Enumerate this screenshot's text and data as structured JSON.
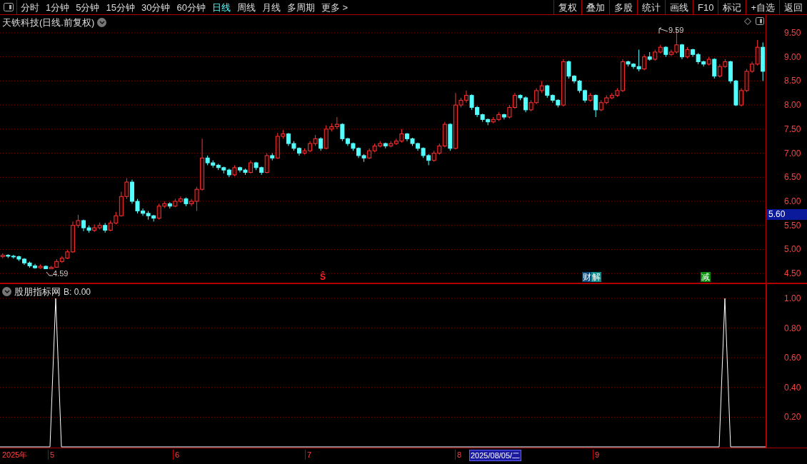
{
  "toolbar": {
    "periods": [
      {
        "label": "分时",
        "selected": false
      },
      {
        "label": "1分钟",
        "selected": false
      },
      {
        "label": "5分钟",
        "selected": false
      },
      {
        "label": "15分钟",
        "selected": false
      },
      {
        "label": "30分钟",
        "selected": false
      },
      {
        "label": "60分钟",
        "selected": false
      },
      {
        "label": "日线",
        "selected": true
      },
      {
        "label": "周线",
        "selected": false
      },
      {
        "label": "月线",
        "selected": false
      },
      {
        "label": "多周期",
        "selected": false
      },
      {
        "label": "更多 >",
        "selected": false
      }
    ],
    "buttons": [
      "复权",
      "叠加",
      "多股",
      "统计",
      "画线",
      "F10",
      "标记",
      "+自选",
      "返回"
    ]
  },
  "price_chart": {
    "title": "天铁科技(日线.前复权)",
    "high_label": "9.59",
    "low_label": "4.59",
    "event_marks": [
      {
        "text": "Ŝ",
        "kind": "signal"
      },
      {
        "text": "财",
        "kind": "finance"
      },
      {
        "text": "解",
        "kind": "unlock"
      },
      {
        "text": "减",
        "kind": "reduce"
      }
    ],
    "current_price": "5.60",
    "chart_data": {
      "type": "candlestick",
      "grid": true,
      "ylim": [
        4.31,
        9.87
      ],
      "categories": [
        null,
        null,
        null,
        null,
        null,
        null,
        null,
        null,
        null,
        null,
        null,
        null,
        null,
        null,
        null,
        null,
        null,
        null,
        null,
        null,
        null,
        null,
        null,
        null,
        null,
        null,
        null,
        null,
        null,
        null,
        null,
        null,
        null,
        null,
        null,
        null,
        null,
        null,
        null,
        null,
        null,
        null,
        null,
        null,
        null,
        null,
        null,
        null,
        null,
        null,
        null,
        null,
        null,
        null,
        null,
        null,
        null,
        null,
        null,
        null,
        null,
        null,
        null,
        null,
        null,
        null,
        null,
        null,
        null,
        null,
        null,
        null,
        null,
        null,
        null,
        null,
        null,
        null,
        null,
        null,
        null,
        null,
        null,
        null,
        null,
        null,
        null,
        null,
        null,
        null,
        null,
        null,
        null,
        null,
        null,
        null,
        null,
        null,
        null,
        null,
        null,
        null,
        null,
        null,
        null,
        null,
        null,
        null,
        null,
        null,
        null,
        null,
        null,
        null,
        null,
        null,
        null,
        null,
        null,
        null,
        null,
        null,
        null,
        null,
        null,
        null,
        null,
        null,
        null,
        null,
        null,
        null,
        null,
        null,
        null,
        null,
        null,
        null,
        null,
        null,
        null,
        null
      ],
      "yticks": [
        {
          "value": 9.5,
          "label": "9.50"
        },
        {
          "value": 9,
          "label": "9.00"
        },
        {
          "value": 8.5,
          "label": "8.50"
        },
        {
          "value": 8,
          "label": "8.00"
        },
        {
          "value": 7.5,
          "label": "7.50"
        },
        {
          "value": 7,
          "label": "7.00"
        },
        {
          "value": 6.5,
          "label": "6.50"
        },
        {
          "value": 6,
          "label": "6.00"
        },
        {
          "value": 5.5,
          "label": "5.50"
        },
        {
          "value": 5,
          "label": "5.00"
        },
        {
          "value": 4.5,
          "label": "4.50"
        }
      ],
      "ohlc": [
        [
          4.85,
          4.92,
          4.82,
          4.88
        ],
        [
          4.88,
          4.9,
          4.82,
          4.86
        ],
        [
          4.86,
          4.89,
          4.81,
          4.85
        ],
        [
          4.85,
          4.87,
          4.76,
          4.8
        ],
        [
          4.8,
          4.82,
          4.68,
          4.72
        ],
        [
          4.72,
          4.75,
          4.62,
          4.66
        ],
        [
          4.66,
          4.7,
          4.6,
          4.62
        ],
        [
          4.62,
          4.69,
          4.6,
          4.65
        ],
        [
          4.65,
          4.67,
          4.59,
          4.6
        ],
        [
          4.6,
          4.66,
          4.6,
          4.63
        ],
        [
          4.63,
          4.8,
          4.62,
          4.75
        ],
        [
          4.75,
          4.86,
          4.72,
          4.82
        ],
        [
          4.82,
          4.99,
          4.8,
          4.95
        ],
        [
          4.95,
          5.58,
          4.93,
          5.5
        ],
        [
          5.5,
          5.72,
          5.45,
          5.6
        ],
        [
          5.6,
          5.62,
          5.38,
          5.45
        ],
        [
          5.45,
          5.5,
          5.35,
          5.4
        ],
        [
          5.4,
          5.52,
          5.36,
          5.45
        ],
        [
          5.45,
          5.56,
          5.42,
          5.5
        ],
        [
          5.5,
          5.55,
          5.35,
          5.4
        ],
        [
          5.4,
          5.6,
          5.38,
          5.55
        ],
        [
          5.55,
          5.78,
          5.52,
          5.7
        ],
        [
          5.7,
          6.2,
          5.68,
          6.1
        ],
        [
          6.1,
          6.48,
          6.05,
          6.4
        ],
        [
          6.4,
          6.45,
          5.95,
          6.0
        ],
        [
          6.0,
          6.05,
          5.75,
          5.8
        ],
        [
          5.8,
          5.85,
          5.7,
          5.75
        ],
        [
          5.75,
          5.8,
          5.62,
          5.7
        ],
        [
          5.7,
          5.72,
          5.58,
          5.65
        ],
        [
          5.65,
          5.95,
          5.62,
          5.9
        ],
        [
          5.9,
          6.0,
          5.86,
          5.95
        ],
        [
          5.95,
          5.98,
          5.85,
          5.9
        ],
        [
          5.9,
          6.05,
          5.88,
          6.0
        ],
        [
          6.0,
          6.1,
          5.97,
          6.05
        ],
        [
          6.05,
          6.08,
          5.9,
          5.95
        ],
        [
          5.95,
          6.05,
          5.9,
          6.0
        ],
        [
          6.0,
          6.3,
          5.8,
          6.25
        ],
        [
          6.25,
          7.3,
          6.22,
          6.9
        ],
        [
          6.9,
          6.95,
          6.75,
          6.8
        ],
        [
          6.8,
          6.85,
          6.7,
          6.75
        ],
        [
          6.75,
          6.78,
          6.65,
          6.7
        ],
        [
          6.7,
          6.72,
          6.58,
          6.65
        ],
        [
          6.65,
          6.68,
          6.5,
          6.55
        ],
        [
          6.55,
          6.75,
          6.52,
          6.7
        ],
        [
          6.7,
          6.72,
          6.6,
          6.65
        ],
        [
          6.65,
          6.68,
          6.55,
          6.6
        ],
        [
          6.6,
          6.85,
          6.58,
          6.8
        ],
        [
          6.8,
          6.82,
          6.65,
          6.7
        ],
        [
          6.7,
          6.72,
          6.55,
          6.6
        ],
        [
          6.6,
          7.0,
          6.58,
          6.95
        ],
        [
          6.95,
          7.0,
          6.85,
          6.9
        ],
        [
          6.9,
          7.42,
          6.88,
          7.35
        ],
        [
          7.35,
          7.48,
          7.3,
          7.4
        ],
        [
          7.4,
          7.42,
          7.15,
          7.2
        ],
        [
          7.2,
          7.25,
          7.05,
          7.1
        ],
        [
          7.1,
          7.12,
          6.95,
          7.0
        ],
        [
          7.0,
          7.1,
          6.97,
          7.05
        ],
        [
          7.05,
          7.25,
          7.02,
          7.2
        ],
        [
          7.2,
          7.38,
          7.15,
          7.3
        ],
        [
          7.3,
          7.33,
          7.05,
          7.1
        ],
        [
          7.1,
          7.58,
          7.08,
          7.5
        ],
        [
          7.5,
          7.62,
          7.45,
          7.55
        ],
        [
          7.55,
          7.75,
          7.5,
          7.6
        ],
        [
          7.6,
          7.62,
          7.25,
          7.3
        ],
        [
          7.3,
          7.32,
          7.15,
          7.2
        ],
        [
          7.2,
          7.22,
          7.05,
          7.1
        ],
        [
          7.1,
          7.12,
          6.9,
          6.95
        ],
        [
          6.95,
          6.98,
          6.82,
          6.9
        ],
        [
          6.9,
          7.1,
          6.88,
          7.05
        ],
        [
          7.05,
          7.2,
          7.02,
          7.15
        ],
        [
          7.15,
          7.25,
          7.12,
          7.2
        ],
        [
          7.2,
          7.22,
          7.1,
          7.15
        ],
        [
          7.15,
          7.25,
          7.12,
          7.2
        ],
        [
          7.2,
          7.3,
          7.17,
          7.25
        ],
        [
          7.25,
          7.5,
          7.22,
          7.4
        ],
        [
          7.4,
          7.42,
          7.25,
          7.3
        ],
        [
          7.3,
          7.32,
          7.15,
          7.2
        ],
        [
          7.2,
          7.22,
          7.05,
          7.1
        ],
        [
          7.1,
          7.12,
          6.9,
          6.95
        ],
        [
          6.95,
          6.98,
          6.75,
          6.85
        ],
        [
          6.85,
          7.05,
          6.82,
          7.0
        ],
        [
          7.0,
          7.2,
          6.97,
          7.15
        ],
        [
          7.15,
          7.65,
          7.12,
          7.6
        ],
        [
          7.6,
          7.62,
          7.05,
          7.1
        ],
        [
          7.1,
          8.25,
          7.08,
          8.0
        ],
        [
          8.0,
          8.15,
          7.95,
          8.1
        ],
        [
          8.1,
          8.3,
          8.05,
          8.2
        ],
        [
          8.2,
          8.22,
          7.9,
          7.95
        ],
        [
          7.95,
          7.98,
          7.75,
          7.8
        ],
        [
          7.8,
          7.82,
          7.65,
          7.7
        ],
        [
          7.7,
          7.72,
          7.58,
          7.65
        ],
        [
          7.65,
          7.75,
          7.62,
          7.7
        ],
        [
          7.7,
          7.85,
          7.67,
          7.8
        ],
        [
          7.8,
          7.82,
          7.7,
          7.75
        ],
        [
          7.75,
          8.0,
          7.72,
          7.95
        ],
        [
          7.95,
          8.25,
          7.92,
          8.2
        ],
        [
          8.2,
          8.22,
          8.1,
          8.15
        ],
        [
          8.15,
          8.18,
          7.85,
          7.9
        ],
        [
          7.9,
          8.1,
          7.87,
          8.05
        ],
        [
          8.05,
          8.35,
          8.02,
          8.3
        ],
        [
          8.3,
          8.5,
          8.25,
          8.4
        ],
        [
          8.4,
          8.42,
          8.15,
          8.2
        ],
        [
          8.2,
          8.22,
          8.05,
          8.1
        ],
        [
          8.1,
          8.12,
          7.95,
          8.0
        ],
        [
          8.0,
          8.95,
          7.97,
          8.9
        ],
        [
          8.9,
          8.92,
          8.55,
          8.6
        ],
        [
          8.6,
          8.62,
          8.45,
          8.5
        ],
        [
          8.5,
          8.52,
          8.25,
          8.3
        ],
        [
          8.3,
          8.32,
          8.05,
          8.1
        ],
        [
          8.1,
          8.25,
          8.07,
          8.2
        ],
        [
          8.2,
          8.22,
          7.75,
          7.9
        ],
        [
          7.9,
          8.1,
          7.87,
          8.05
        ],
        [
          8.05,
          8.2,
          8.02,
          8.15
        ],
        [
          8.15,
          8.25,
          8.12,
          8.2
        ],
        [
          8.2,
          8.35,
          8.17,
          8.3
        ],
        [
          8.3,
          8.95,
          8.27,
          8.9
        ],
        [
          8.9,
          8.92,
          8.8,
          8.85
        ],
        [
          8.85,
          8.87,
          8.75,
          8.8
        ],
        [
          8.8,
          9.15,
          8.7,
          8.75
        ],
        [
          8.75,
          9.05,
          8.72,
          9.0
        ],
        [
          9.0,
          9.1,
          8.92,
          8.95
        ],
        [
          8.95,
          9.15,
          8.92,
          9.1
        ],
        [
          9.1,
          9.25,
          9.07,
          9.2
        ],
        [
          9.2,
          9.22,
          9.0,
          9.05
        ],
        [
          9.05,
          9.15,
          9.02,
          9.1
        ],
        [
          9.1,
          9.59,
          9.07,
          9.25
        ],
        [
          9.25,
          9.27,
          8.95,
          9.0
        ],
        [
          9.0,
          9.2,
          8.97,
          9.15
        ],
        [
          9.15,
          9.17,
          9.0,
          9.05
        ],
        [
          9.05,
          9.08,
          8.85,
          8.9
        ],
        [
          8.9,
          8.92,
          8.8,
          8.85
        ],
        [
          8.85,
          9.0,
          8.82,
          8.95
        ],
        [
          8.95,
          8.97,
          8.55,
          8.6
        ],
        [
          8.6,
          8.85,
          8.57,
          8.8
        ],
        [
          8.8,
          8.95,
          8.77,
          8.9
        ],
        [
          8.9,
          8.92,
          8.45,
          8.5
        ],
        [
          8.5,
          8.52,
          7.98,
          8.0
        ],
        [
          8.0,
          8.35,
          7.97,
          8.3
        ],
        [
          8.3,
          8.75,
          8.27,
          8.7
        ],
        [
          8.7,
          8.9,
          8.67,
          8.85
        ],
        [
          8.85,
          9.35,
          8.82,
          9.2
        ],
        [
          9.2,
          9.3,
          8.5,
          8.7
        ]
      ]
    }
  },
  "indicator": {
    "name": "股朋指标网",
    "value": "B: 0.00",
    "axis_ticks": [
      "1.00",
      "0.80",
      "0.60",
      "0.40",
      "0.20"
    ]
  },
  "date_axis": [
    {
      "text": "2025年",
      "kind": "year"
    },
    {
      "text": "5",
      "kind": "month"
    },
    {
      "text": "6",
      "kind": "month"
    },
    {
      "text": "7",
      "kind": "month"
    },
    {
      "text": "8",
      "kind": "month"
    },
    {
      "text": "2025/08/05/二",
      "kind": "cursor"
    },
    {
      "text": "9",
      "kind": "month"
    }
  ]
}
